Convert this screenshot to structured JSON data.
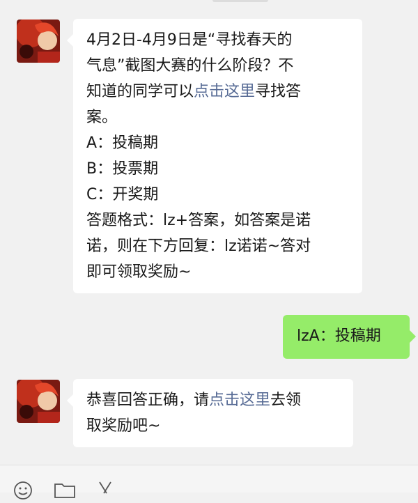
{
  "messages": [
    {
      "sender": "bot",
      "lines": [
        {
          "parts": [
            {
              "text": "4月2日-4月9日是“寻找春天的",
              "link": false
            }
          ]
        },
        {
          "parts": [
            {
              "text": "气息”截图大赛的什么阶段？不",
              "link": false
            }
          ]
        },
        {
          "parts": [
            {
              "text": "知道的同学可以",
              "link": false
            },
            {
              "text": "点击这里",
              "link": true
            },
            {
              "text": "寻找答",
              "link": false
            }
          ]
        },
        {
          "parts": [
            {
              "text": "案。",
              "link": false
            }
          ]
        },
        {
          "parts": [
            {
              "text": "A：投稿期",
              "link": false
            }
          ]
        },
        {
          "parts": [
            {
              "text": "B：投票期",
              "link": false
            }
          ]
        },
        {
          "parts": [
            {
              "text": "C：开奖期",
              "link": false
            }
          ]
        },
        {
          "parts": [
            {
              "text": "答题格式：lz+答案，如答案是诺",
              "link": false
            }
          ]
        },
        {
          "parts": [
            {
              "text": "诺，则在下方回复：lz诺诺~答对",
              "link": false
            }
          ]
        },
        {
          "parts": [
            {
              "text": "即可领取奖励~",
              "link": false
            }
          ]
        }
      ]
    },
    {
      "sender": "me",
      "text": "lzA：投稿期"
    },
    {
      "sender": "bot",
      "lines": [
        {
          "parts": [
            {
              "text": "恭喜回答正确，请",
              "link": false
            },
            {
              "text": "点击这里",
              "link": true
            },
            {
              "text": "去领",
              "link": false
            }
          ]
        },
        {
          "parts": [
            {
              "text": "取奖励吧~",
              "link": false
            }
          ]
        }
      ]
    }
  ],
  "colors": {
    "chat_bg": "#f1f1f1",
    "bot_bubble": "#ffffff",
    "my_bubble": "#95ec69",
    "link": "#576b95"
  },
  "icons": [
    "emoji-icon",
    "folder-icon",
    "scissors-icon"
  ]
}
